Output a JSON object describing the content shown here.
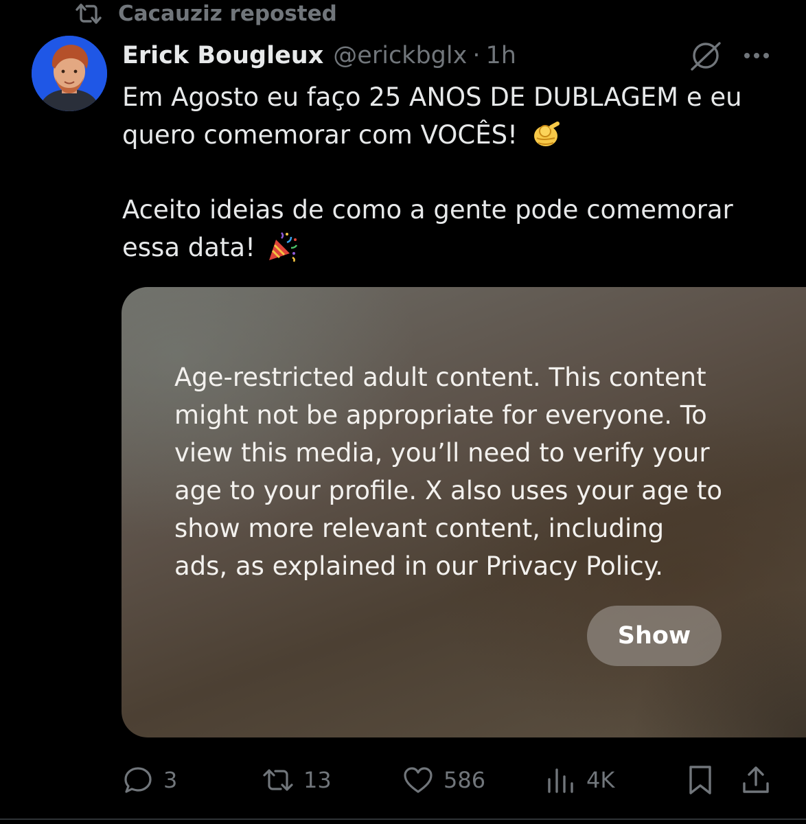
{
  "repost": {
    "label": "Cacauziz reposted",
    "icon": "repost-icon"
  },
  "author": {
    "display_name": "Erick Bougleux",
    "handle": "@erickbglx",
    "separator": "·",
    "time": "1h",
    "avatar_color": "#1f57e6"
  },
  "tweet": {
    "line1": "Em Agosto eu faço 25 ANOS DE DUBLAGEM e eu",
    "line2": "quero comemorar com VOCÊS!",
    "line3": "Aceito ideias de como a gente pode comemorar",
    "line4": "essa data!",
    "emoji1": "pointing-at-viewer-emoji",
    "emoji2": "party-popper-emoji"
  },
  "media": {
    "warning_lines": [
      "Age-restricted adult content. This content",
      "might not be appropriate for everyone. To",
      "view this media, you’ll need to verify your",
      "age to your profile. X also uses your age to",
      "show more relevant content, including",
      "ads, as explained in our Privacy Policy."
    ],
    "show_label": "Show"
  },
  "actions": {
    "reply_count": "3",
    "repost_count": "13",
    "like_count": "586",
    "views_count": "4K"
  },
  "colors": {
    "background": "#000000",
    "text": "#e7e9ea",
    "secondary": "#71767b"
  }
}
